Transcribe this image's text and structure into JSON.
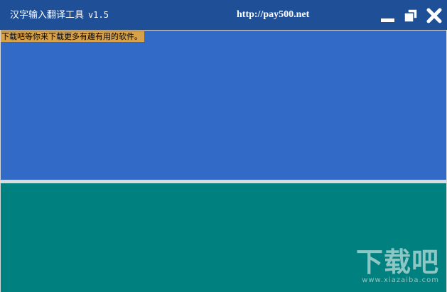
{
  "titlebar": {
    "app_name": "汉字输入翻译工具",
    "version": "v1.5",
    "url": "http://pay500.net",
    "controls": {
      "minimize_icon": "minimize-icon",
      "maximize_icon": "restore-icon",
      "close_icon": "close-icon"
    }
  },
  "top_panel": {
    "notice": "下载吧等你来下载更多有趣有用的软件。"
  },
  "watermark": {
    "logo_text": "下载吧",
    "site": "www.xiazaiba.com"
  },
  "colors": {
    "titlebar": "#1f4f96",
    "top_panel": "#316ac7",
    "bottom_panel": "#00807e",
    "notice_bg": "#d7a24a"
  }
}
